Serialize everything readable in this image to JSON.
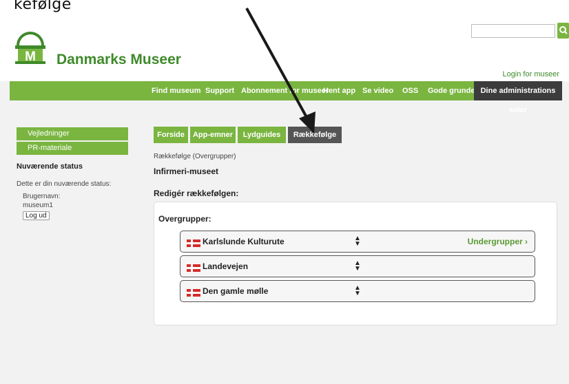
{
  "caption": "kefølge",
  "site": {
    "name": "Danmarks Museer",
    "login": "Login for museer"
  },
  "search": {
    "placeholder": ""
  },
  "nav": {
    "items": [
      "Find museum",
      "Support",
      "Abonnement for museer",
      "Hent app",
      "Se video",
      "OSS",
      "Gode grunde"
    ],
    "admin": "Dine administrations sider"
  },
  "sidebar": {
    "buttons": [
      "Vejledninger",
      "PR-materiale"
    ],
    "status_title": "Nuværende status",
    "status_text": "Dette er din nuværende status:",
    "user_label": "Brugernavn:",
    "username": "museum1",
    "logout": "Log ud"
  },
  "tabs": [
    "Forside",
    "App-emner",
    "Lydguides",
    "Rækkefølge"
  ],
  "main": {
    "breadcrumb": "Rækkefølge (Overgrupper)",
    "museum": "Infirmeri-museet",
    "edit_label": "Redigér rækkefølgen:",
    "panel_title": "Overgrupper:",
    "rows": [
      "Karlslunde Kulturute",
      "Landevejen",
      "Den gamle mølle"
    ],
    "sub_link": "Undergrupper ›"
  },
  "colors": {
    "accent": "#7ab540",
    "dark": "#3c3c3c",
    "flag": "#d62b2b",
    "link": "#3e8a2a"
  },
  "icons": [
    "logo-icon",
    "search-icon",
    "denmark-flag-icon",
    "sort-icon",
    "annotation-arrow"
  ]
}
